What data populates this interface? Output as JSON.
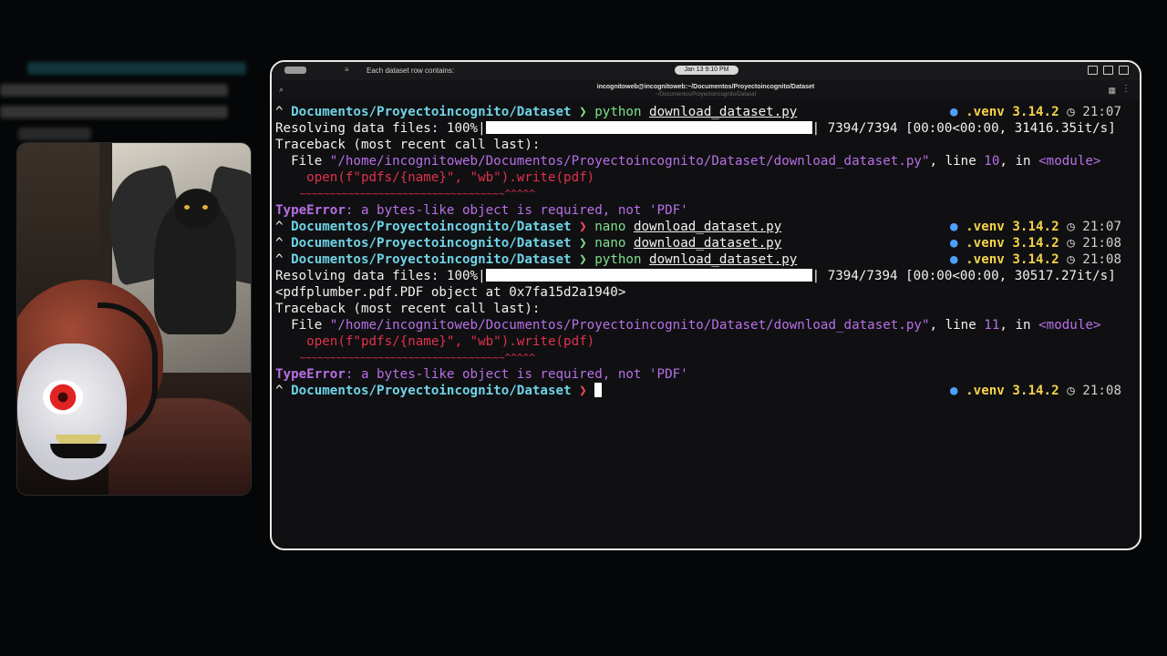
{
  "topbar": {
    "menu_glyph": "≡",
    "hint": "Each dataset row contains:",
    "clock": "Jan 13   9:10 PM"
  },
  "titlebar": {
    "title": "incognitoweb@incognitoweb:~/Documentos/Proyectoincognito/Dataset",
    "subtitle": "~/Documentos/Proyectoincognito/Dataset"
  },
  "prompt": {
    "caret": "^",
    "path": "Documentos/Proyectoincognito/Dataset",
    "arrow": "❯",
    "venv_dot": "●",
    "venv": ".venv",
    "py_version": "3.14.2",
    "clock_glyph": "◷"
  },
  "lines": {
    "cmd1": {
      "cmd": "python",
      "arg": "download_dataset.py",
      "time": "21:07"
    },
    "progress1": {
      "prefix": "Resolving data files: 100%|",
      "suffix": "| 7394/7394 [00:00<00:00, 31416.35it/s]"
    },
    "tb1_head": "Traceback (most recent call last):",
    "tb1_file_pre": "  File ",
    "tb1_file_path": "\"/home/incognitoweb/Documentos/Proyectoincognito/Dataset/download_dataset.py\"",
    "tb1_line_word": ", line ",
    "tb1_line_no": "10",
    "tb1_in": ", in ",
    "tb1_module": "<module>",
    "tb1_code": "    open(f\"pdfs/{name}\", \"wb\").write(pdf)",
    "tb1_marker": "    ~~~~~~~~~~~~~~~~~~~~~~~~~~~~~~~~~~^^^^^",
    "err1_type": "TypeError",
    "err1_msg": ": a bytes-like object is required, not 'PDF'",
    "cmd2": {
      "cmd": "nano",
      "arg": "download_dataset.py",
      "time": "21:07"
    },
    "cmd3": {
      "cmd": "nano",
      "arg": "download_dataset.py",
      "time": "21:08"
    },
    "cmd4": {
      "cmd": "python",
      "arg": "download_dataset.py",
      "time": "21:08"
    },
    "progress2": {
      "prefix": "Resolving data files: 100%|",
      "suffix": "| 7394/7394 [00:00<00:00, 30517.27it/s]"
    },
    "pdf_obj": "<pdfplumber.pdf.PDF object at 0x7fa15d2a1940>",
    "tb2_head": "Traceback (most recent call last):",
    "tb2_file_pre": "  File ",
    "tb2_file_path": "\"/home/incognitoweb/Documentos/Proyectoincognito/Dataset/download_dataset.py\"",
    "tb2_line_word": ", line ",
    "tb2_line_no": "11",
    "tb2_in": ", in ",
    "tb2_module": "<module>",
    "tb2_code": "    open(f\"pdfs/{name}\", \"wb\").write(pdf)",
    "tb2_marker": "    ~~~~~~~~~~~~~~~~~~~~~~~~~~~~~~~~~~^^^^^",
    "err2_type": "TypeError",
    "err2_msg": ": a bytes-like object is required, not 'PDF'",
    "final_time": "21:08"
  }
}
